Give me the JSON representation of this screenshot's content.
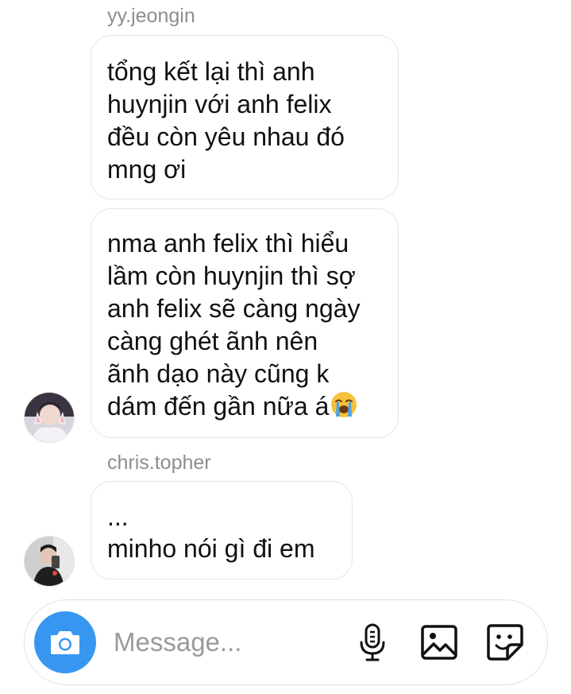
{
  "thread": {
    "messages": [
      {
        "sender": "yy.jeongin",
        "lines": [
          "tổng kết lại thì anh",
          "huynjin với anh felix",
          "đều còn yêu nhau đó",
          "mng ơi"
        ]
      },
      {
        "sender": "yy.jeongin",
        "lines": [
          "nma anh felix thì hiểu",
          "lầm còn huynjin thì sợ",
          "anh felix sẽ càng ngày",
          "càng ghét ãnh nên",
          "ãnh dạo này cũng k",
          "dám đến gần nữa á"
        ],
        "trailing_emoji": "loudly-crying-face"
      },
      {
        "sender": "chris.topher",
        "lines": [
          "...",
          "minho nói gì đi em"
        ]
      }
    ]
  },
  "composer": {
    "placeholder": "Message...",
    "camera_icon": "camera-icon",
    "mic_icon": "microphone-icon",
    "gallery_icon": "gallery-icon",
    "sticker_icon": "sticker-icon"
  },
  "colors": {
    "accent": "#3797f0",
    "username": "#8e8e8e",
    "bubble_border": "#e6e6e6"
  }
}
